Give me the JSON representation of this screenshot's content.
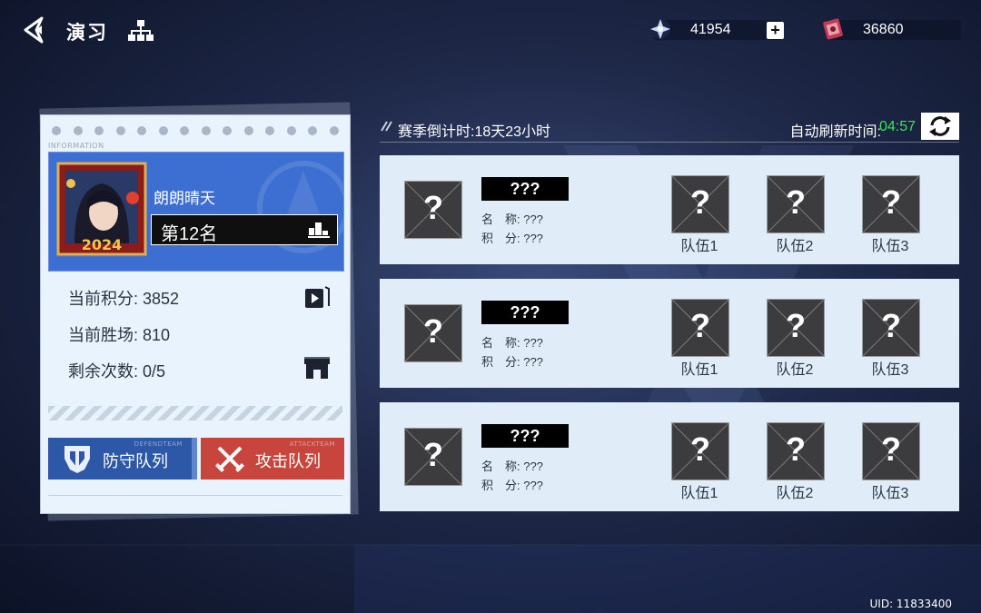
{
  "header": {
    "title": "演习",
    "currency1": "41954",
    "currency2": "36860",
    "plus": "+"
  },
  "card": {
    "info_tag": "INFORMATION",
    "player_name": "朗朗晴天",
    "avatar_year": "2024",
    "rank": "第12名",
    "stats": {
      "points": "当前积分: 3852",
      "wins": "当前胜场: 810",
      "remaining": "剩余次数: 0/5"
    },
    "defense_team": {
      "label": "防守队列",
      "sub": "DEFENDTEAM"
    },
    "attack_team": {
      "label": "攻击队列",
      "sub": "ATTACKTEAM"
    }
  },
  "season": {
    "countdown": "赛季倒计时:18天23小时",
    "refresh_label": "自动刷新时间:",
    "refresh_time": "04:57"
  },
  "opponents": [
    {
      "name": "???",
      "name_line": "名　称: ???",
      "score_line": "积　分: ???",
      "teams": [
        "队伍1",
        "队伍2",
        "队伍3"
      ]
    },
    {
      "name": "???",
      "name_line": "名　称: ???",
      "score_line": "积　分: ???",
      "teams": [
        "队伍1",
        "队伍2",
        "队伍3"
      ]
    },
    {
      "name": "???",
      "name_line": "名　称: ???",
      "score_line": "积　分: ???",
      "teams": [
        "队伍1",
        "队伍2",
        "队伍3"
      ]
    }
  ],
  "placeholder": "?",
  "uid": "UID: 11833400",
  "colors": {
    "refresh_time": "#3ee05a",
    "defense": "#2d58a8",
    "attack": "#c8453e",
    "profile": "#3d6ed2"
  }
}
